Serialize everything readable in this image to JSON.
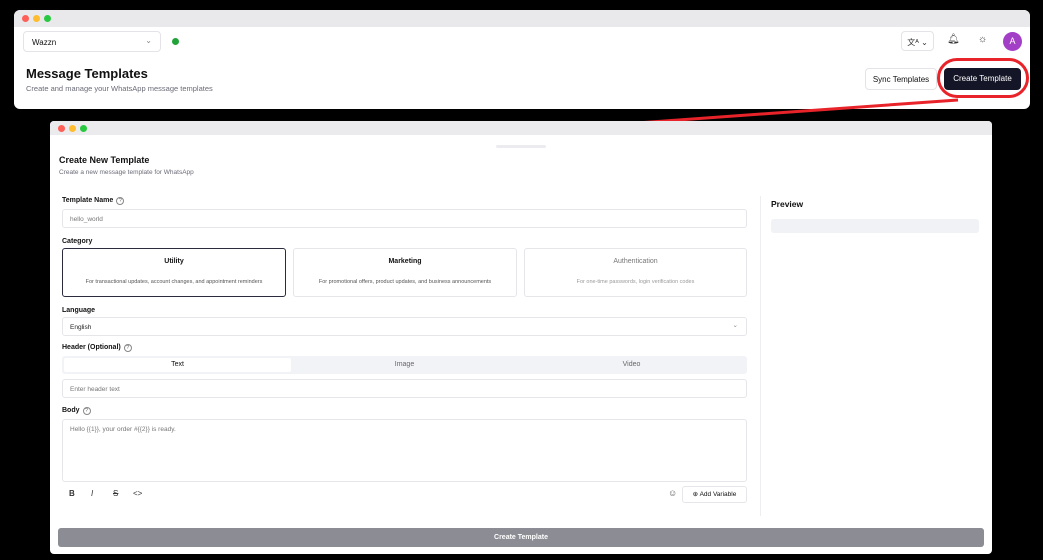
{
  "header": {
    "workspace": "Wazzn",
    "lang_icon": "translate-icon",
    "avatar_initial": "A",
    "title": "Message Templates",
    "subtitle": "Create and manage your WhatsApp message templates",
    "sync_label": "Sync Templates",
    "create_label": "Create Template"
  },
  "dialog": {
    "title": "Create New Template",
    "subtitle": "Create a new message template for WhatsApp",
    "name_label": "Template Name",
    "name_value": "hello_world",
    "category_label": "Category",
    "categories": [
      {
        "title": "Utility",
        "desc": "For transactional updates, account changes, and appointment reminders"
      },
      {
        "title": "Marketing",
        "desc": "For promotional offers, product updates, and business announcements"
      },
      {
        "title": "Authentication",
        "desc": "For one-time passwords, login verification codes"
      }
    ],
    "language_label": "Language",
    "language_value": "English",
    "header_label": "Header (Optional)",
    "header_tabs": [
      "Text",
      "Image",
      "Video"
    ],
    "header_placeholder": "Enter header text",
    "body_label": "Body",
    "body_placeholder": "Hello {{1}}, your order #{{2}} is ready.",
    "toolbar": {
      "bold": "B",
      "italic": "I",
      "strike": "S",
      "code": "<>"
    },
    "add_variable": "Add Variable",
    "preview_title": "Preview",
    "submit_label": "Create Template"
  },
  "colors": {
    "accent": "#141526",
    "highlight": "#e8242a",
    "avatar": "#a33ec7",
    "status": "#22a33a"
  }
}
